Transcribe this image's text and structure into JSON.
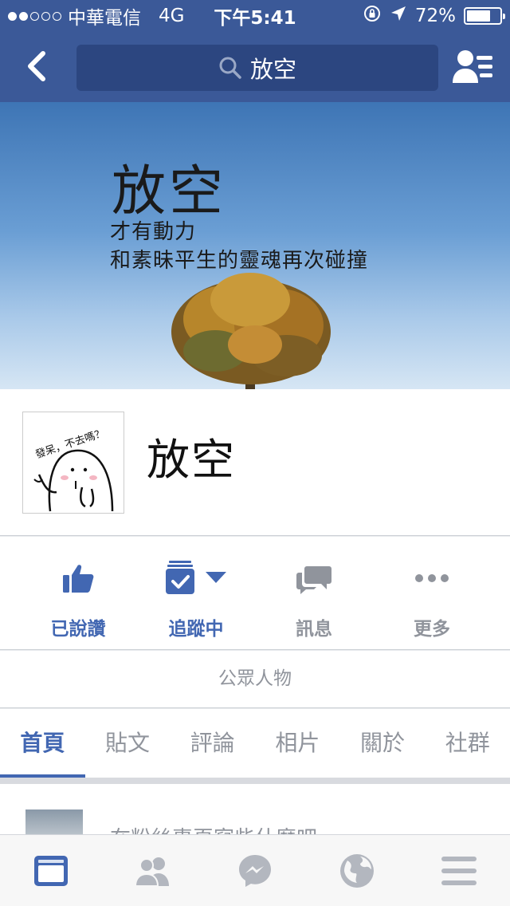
{
  "status_bar": {
    "carrier": "中華電信",
    "network": "4G",
    "time": "下午5:41",
    "battery": "72%",
    "battery_level": 0.72
  },
  "nav": {
    "search_text": "放空"
  },
  "cover": {
    "title": "放空",
    "line1": "才有動力",
    "line2": "和素昧平生的靈魂再次碰撞"
  },
  "profile": {
    "name": "放空",
    "avatar_text": "發呆，不去嗎？"
  },
  "actions": {
    "like": "已說讚",
    "follow": "追蹤中",
    "message": "訊息",
    "more": "更多"
  },
  "category": "公眾人物",
  "tabs": [
    "首頁",
    "貼文",
    "評論",
    "相片",
    "關於",
    "社群"
  ],
  "composer": {
    "prompt": "在粉絲專頁寫些什麼吧"
  },
  "colors": {
    "brand": "#3b5998",
    "accent": "#4267b2",
    "muted": "#90949c"
  }
}
